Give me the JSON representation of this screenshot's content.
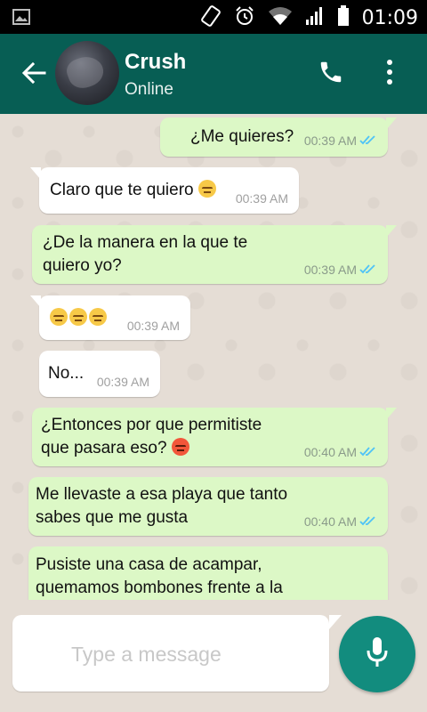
{
  "status_bar": {
    "time": "01:09"
  },
  "header": {
    "contact_name": "Crush",
    "status": "Online"
  },
  "messages": [
    {
      "direction": "out",
      "text": "¿Me quieres?",
      "time": "00:39 AM",
      "read": true
    },
    {
      "direction": "in",
      "text": "Claro que te quiero",
      "emoji": [
        "unamused"
      ],
      "time": "00:39 AM"
    },
    {
      "direction": "out",
      "line1": "¿De la manera en la que te",
      "line2": "quiero yo?",
      "time": "00:39 AM",
      "read": true
    },
    {
      "direction": "in",
      "emoji": [
        "unamused",
        "unamused",
        "unamused"
      ],
      "time": "00:39 AM"
    },
    {
      "direction": "in",
      "text": "No...",
      "time": "00:39 AM"
    },
    {
      "direction": "out",
      "line1": "¿Entonces por que permitiste",
      "line2": "que pasara eso?",
      "emoji": [
        "angry"
      ],
      "time": "00:40 AM",
      "read": true
    },
    {
      "direction": "out",
      "line1": "Me llevaste a esa playa que tanto",
      "line2": "sabes que me gusta",
      "time": "00:40 AM",
      "read": true
    },
    {
      "direction": "out",
      "line1": "Pusiste una casa de acampar,",
      "line2": "quemamos bombones frente a la"
    }
  ],
  "composer": {
    "placeholder": "Type a message"
  },
  "colors": {
    "header": "#075e54",
    "chat_bg": "#e5ddd5",
    "out_bubble": "#dcf8c6",
    "in_bubble": "#ffffff",
    "mic_button": "#128c7e",
    "read_ticks": "#4fc3f7"
  },
  "icons": [
    "picture-icon",
    "vibrate-icon",
    "alarm-icon",
    "wifi-icon",
    "signal-icon",
    "battery-icon",
    "back-arrow-icon",
    "phone-icon",
    "more-vert-icon",
    "double-check-icon",
    "unamused-emoji",
    "angry-emoji",
    "microphone-icon"
  ]
}
